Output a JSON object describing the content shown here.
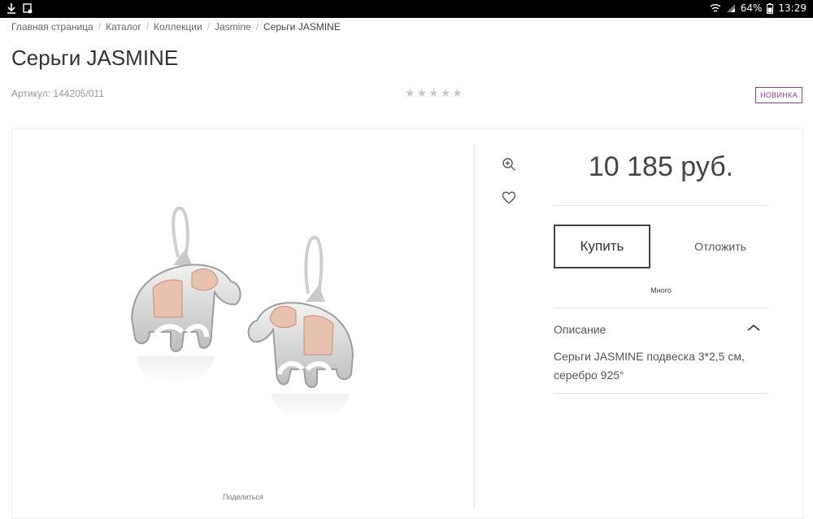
{
  "statusbar": {
    "battery": "64%",
    "time": "13:29"
  },
  "breadcrumb": [
    {
      "label": "Главная страница"
    },
    {
      "label": "Каталог"
    },
    {
      "label": "Коллекции"
    },
    {
      "label": "Jasmine"
    },
    {
      "label": "Серьги JASMINE"
    }
  ],
  "product": {
    "title": "Серьги JASMINE",
    "article": "Артикул: 144205/011",
    "rating": 0,
    "rating_max": 5,
    "badge": "НОВИНКА",
    "price": "10 185 руб.",
    "buy_label": "Купить",
    "defer_label": "Отложить",
    "stock": "Много",
    "share_label": "Поделиться",
    "description_title": "Описание",
    "description_text": "Серьги JASMINE подвеска 3*2,5 см, серебро 925°"
  },
  "icons": {
    "zoom": "magnifier-plus-icon",
    "wishlist": "heart-icon",
    "collapse": "chevron-up-icon"
  },
  "colors": {
    "badge": "#8a3f8e",
    "rose_gold": "#e8c1b0",
    "silver": "#d9d9d9"
  }
}
